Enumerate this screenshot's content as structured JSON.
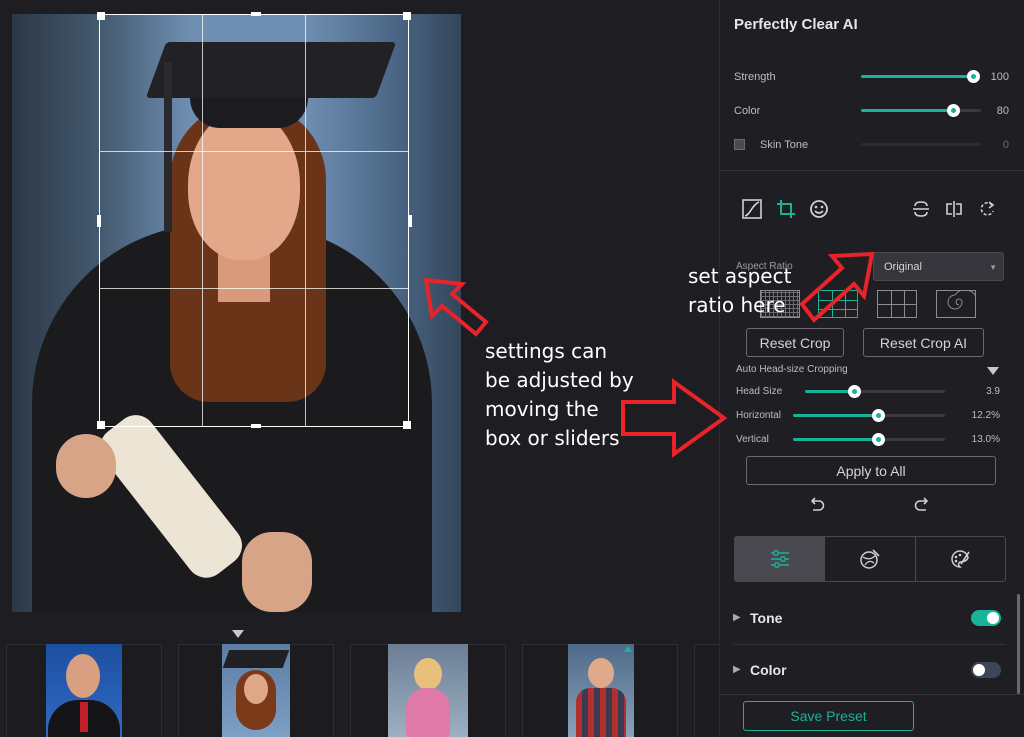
{
  "panel": {
    "title": "Perfectly Clear AI",
    "sliders": [
      {
        "label": "Strength",
        "value": "100",
        "level": 1.0
      },
      {
        "label": "Color",
        "value": "80",
        "level": 0.8
      },
      {
        "label": "Skin Tone",
        "value": "0",
        "level": 0.0
      }
    ],
    "toolbar_icons": [
      "curves-icon",
      "crop-icon",
      "face-icon",
      "straighten-icon",
      "flip-icon",
      "rotate-icon"
    ],
    "aspect_ratio": {
      "label": "Aspect Ratio",
      "selected": "Original"
    },
    "reset_crop_label": "Reset Crop",
    "reset_crop_ai_label": "Reset Crop AI",
    "auto_head": {
      "label": "Auto Head-size Cropping",
      "sliders": [
        {
          "label": "Head Size",
          "value": "3.9",
          "level": 0.4
        },
        {
          "label": "Horizontal",
          "value": "12.2%",
          "level": 0.55
        },
        {
          "label": "Vertical",
          "value": "13.0%",
          "level": 0.55
        }
      ]
    },
    "apply_all_label": "Apply to All",
    "sections": [
      {
        "label": "Tone",
        "on": true
      },
      {
        "label": "Color",
        "on": false
      }
    ],
    "save_preset_label": "Save Preset"
  },
  "annotations": {
    "aspect_note_line1": "set aspect",
    "aspect_note_line2": "ratio here",
    "settings_note_line1": "settings can",
    "settings_note_line2": "be adjusted by",
    "settings_note_line3": "moving the",
    "settings_note_line4": "box or sliders"
  },
  "colors": {
    "accent": "#19b39a",
    "annotation_arrow": "#e8232a"
  }
}
